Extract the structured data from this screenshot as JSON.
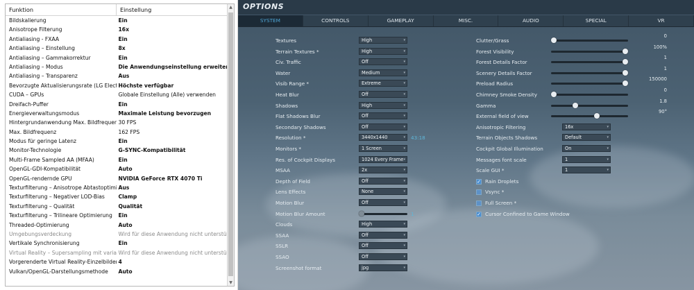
{
  "nvidia": {
    "header": {
      "col1": "Funktion",
      "col2": "Einstellung"
    },
    "rows": [
      {
        "name": "Bildskalierung",
        "value": "Ein",
        "style": "bold"
      },
      {
        "name": "Anisotrope Filterung",
        "value": "16x",
        "style": "bold"
      },
      {
        "name": "Antialiasing - FXAA",
        "value": "Ein",
        "style": "bold"
      },
      {
        "name": "Antialiasing – Einstellung",
        "value": "8x",
        "style": "bold"
      },
      {
        "name": "Antialiasing – Gammakorrektur",
        "value": "Ein",
        "style": "bold"
      },
      {
        "name": "Antialiasing – Modus",
        "value": "Die Anwendungseinstellung erweitern",
        "style": "bold"
      },
      {
        "name": "Antialiasing – Transparenz",
        "value": "Aus",
        "style": "bold"
      },
      {
        "name": "Bevorzugte Aktualisierungsrate (LG Electr...",
        "value": "Höchste verfügbar",
        "style": "bold"
      },
      {
        "name": "CUDA – GPUs",
        "value": "Globale Einstellung (Alle) verwenden",
        "style": "normal"
      },
      {
        "name": "Dreifach-Puffer",
        "value": "Ein",
        "style": "bold"
      },
      {
        "name": "Energieverwaltungsmodus",
        "value": "Maximale Leistung bevorzugen",
        "style": "bold"
      },
      {
        "name": "Hintergrundanwendung Max. Bildfrequenz",
        "value": "30 FPS",
        "style": "normal"
      },
      {
        "name": "Max. Bildfrequenz",
        "value": "162 FPS",
        "style": "normal"
      },
      {
        "name": "Modus für geringe Latenz",
        "value": "Ein",
        "style": "bold"
      },
      {
        "name": "Monitor-Technologie",
        "value": "G-SYNC-Kompatibilität",
        "style": "bold"
      },
      {
        "name": "Multi-Frame Sampled AA (MFAA)",
        "value": "Ein",
        "style": "bold"
      },
      {
        "name": "OpenGL-GDI-Kompatibilität",
        "value": "Auto",
        "style": "bold"
      },
      {
        "name": "OpenGL-rendernde GPU",
        "value": "NVIDIA GeForce RTX 4070 Ti",
        "style": "bold"
      },
      {
        "name": "Texturfilterung – Anisotrope Abtastoptimi...",
        "value": "Aus",
        "style": "bold"
      },
      {
        "name": "Texturfilterung – Negativer LOD-Bias",
        "value": "Clamp",
        "style": "bold"
      },
      {
        "name": "Texturfilterung – Qualität",
        "value": "Qualität",
        "style": "bold"
      },
      {
        "name": "Texturfilterung – Trilineare Optimierung",
        "value": "Ein",
        "style": "bold"
      },
      {
        "name": "Threaded-Optimierung",
        "value": "Auto",
        "style": "bold"
      },
      {
        "name": "Umgebungsverdeckung",
        "value": "Wird für diese Anwendung nicht unterstützt",
        "style": "gray"
      },
      {
        "name": "Vertikale Synchronisierung",
        "value": "Ein",
        "style": "bold"
      },
      {
        "name": "Virtual Reality – Supersampling mit variabl...",
        "value": "Wird für diese Anwendung nicht unterstützt",
        "style": "gray"
      },
      {
        "name": "Vorgerenderte Virtual Reality-Einzelbilder",
        "value": "4",
        "style": "bold"
      },
      {
        "name": "Vulkan/OpenGL-Darstellungsmethode",
        "value": "Auto",
        "style": "bold"
      }
    ]
  },
  "options": {
    "title": "OPTIONS",
    "tabs": [
      {
        "label": "SYSTEM",
        "active": true
      },
      {
        "label": "CONTROLS",
        "active": false
      },
      {
        "label": "GAMEPLAY",
        "active": false
      },
      {
        "label": "MISC.",
        "active": false
      },
      {
        "label": "AUDIO",
        "active": false
      },
      {
        "label": "SPECIAL",
        "active": false
      },
      {
        "label": "VR",
        "active": false
      }
    ],
    "left": [
      {
        "label": "Textures",
        "type": "dropdown",
        "value": "High"
      },
      {
        "label": "Terrain Textures *",
        "type": "dropdown",
        "value": "High"
      },
      {
        "label": "Civ. Traffic",
        "type": "dropdown",
        "value": "Off"
      },
      {
        "label": "Water",
        "type": "dropdown",
        "value": "Medium"
      },
      {
        "label": "Visib Range *",
        "type": "dropdown",
        "value": "Extreme"
      },
      {
        "label": "Heat Blur",
        "type": "dropdown",
        "value": "Off"
      },
      {
        "label": "Shadows",
        "type": "dropdown",
        "value": "High"
      },
      {
        "label": "Flat Shadows Blur",
        "type": "dropdown",
        "value": "Off"
      },
      {
        "label": "Secondary Shadows",
        "type": "dropdown",
        "value": "Off"
      },
      {
        "label": "Resolution *",
        "type": "dropdown",
        "value": "3440x1440",
        "note": "43:18"
      },
      {
        "label": "Monitors *",
        "type": "dropdown",
        "value": "1 Screen"
      },
      {
        "label": "Res. of Cockpit Displays",
        "type": "dropdown",
        "value": "1024 Every Frame"
      },
      {
        "label": "MSAA",
        "type": "dropdown",
        "value": "2x"
      },
      {
        "label": "Depth of Field",
        "type": "dropdown",
        "value": "Off"
      },
      {
        "label": "Lens Effects",
        "type": "dropdown",
        "value": "None"
      },
      {
        "label": "Motion Blur",
        "type": "dropdown",
        "value": "Off"
      },
      {
        "label": "Motion Blur Amount",
        "type": "slider",
        "value": "1",
        "fraction": 0.0
      },
      {
        "label": "Clouds",
        "type": "dropdown",
        "value": "High"
      },
      {
        "label": "SSAA",
        "type": "dropdown",
        "value": "Off"
      },
      {
        "label": "SSLR",
        "type": "dropdown",
        "value": "Off"
      },
      {
        "label": "SSAO",
        "type": "dropdown",
        "value": "Off"
      },
      {
        "label": "Screenshot format",
        "type": "dropdown",
        "value": "jpg"
      }
    ],
    "right_sliders": [
      {
        "label": "Clutter/Grass",
        "value": "0",
        "fraction": 0.0
      },
      {
        "label": "Forest Visibility",
        "value": "100%",
        "fraction": 1.0
      },
      {
        "label": "Forest Details Factor",
        "value": "1",
        "fraction": 1.0
      },
      {
        "label": "Scenery Details Factor",
        "value": "1",
        "fraction": 1.0
      },
      {
        "label": "Preload Radius",
        "value": "150000",
        "fraction": 1.0
      },
      {
        "label": "Chimney Smoke Density",
        "value": "0",
        "fraction": 0.0
      },
      {
        "label": "Gamma",
        "value": "1.8",
        "fraction": 0.3
      },
      {
        "label": "External field of view",
        "value": "90°",
        "fraction": 0.6
      }
    ],
    "right_dropdowns": [
      {
        "label": "Anisotropic Filtering",
        "value": "16x"
      },
      {
        "label": "Terrain Objects Shadows",
        "value": "Default"
      },
      {
        "label": "Cockpit Global Illumination",
        "value": "On"
      },
      {
        "label": "Messages font scale",
        "value": "1"
      },
      {
        "label": "Scale GUI *",
        "value": "1"
      }
    ],
    "checkboxes": [
      {
        "label": "Rain Droplets",
        "checked": true
      },
      {
        "label": "Vsync *",
        "checked": false
      },
      {
        "label": "Full Screen *",
        "checked": false
      },
      {
        "label": "Cursor Confined to Game Window",
        "checked": true
      }
    ]
  }
}
